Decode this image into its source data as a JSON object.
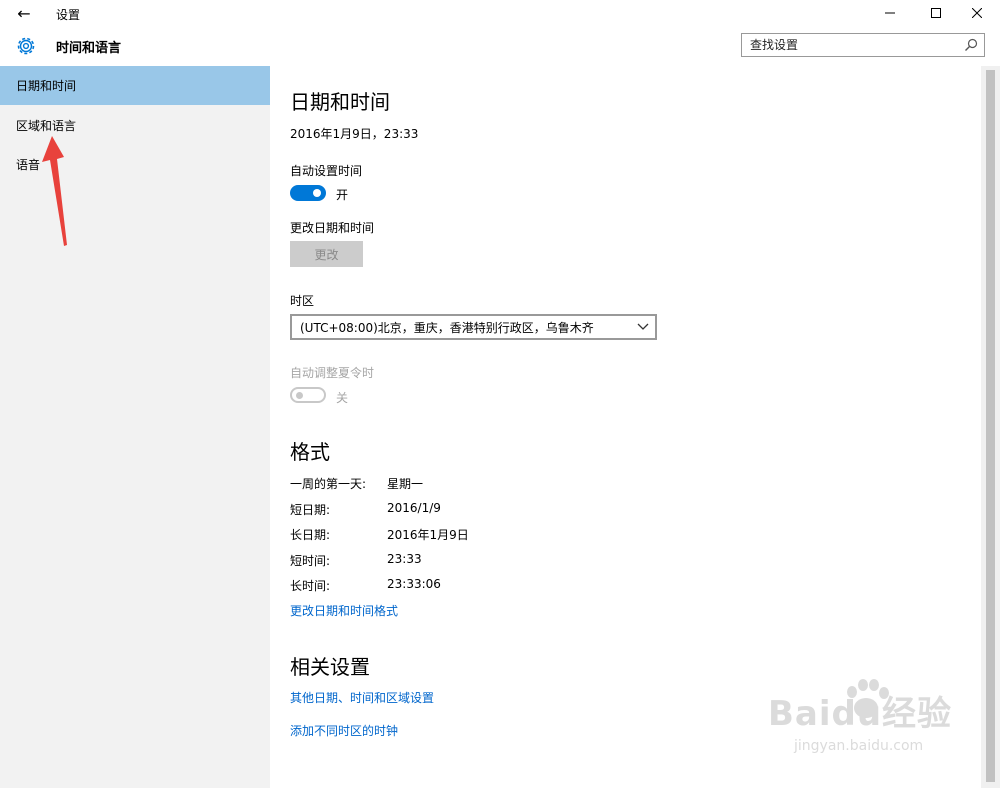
{
  "window": {
    "title": "设置",
    "back_icon": "←",
    "minimize_icon": "—",
    "maximize_icon": "☐",
    "close_icon": "✕"
  },
  "header": {
    "title": "时间和语言",
    "search_placeholder": "查找设置",
    "accent": "#0078d7"
  },
  "sidebar": {
    "items": [
      {
        "label": "日期和时间",
        "active": true
      },
      {
        "label": "区域和语言",
        "active": false
      },
      {
        "label": "语音",
        "active": false
      }
    ],
    "active_color": "#99c7e8",
    "annotation_arrow_color": "#e8423c"
  },
  "main": {
    "section_datetime": {
      "heading": "日期和时间",
      "current": "2016年1月9日，23:33",
      "auto_time_label": "自动设置时间",
      "auto_time_state": "开",
      "change_label": "更改日期和时间",
      "change_button": "更改",
      "timezone_label": "时区",
      "timezone_value": "(UTC+08:00)北京，重庆，香港特别行政区，乌鲁木齐",
      "dst_label": "自动调整夏令时",
      "dst_state": "关"
    },
    "section_format": {
      "heading": "格式",
      "rows": [
        {
          "key": "一周的第一天:",
          "value": "星期一"
        },
        {
          "key": "短日期:",
          "value": "2016/1/9"
        },
        {
          "key": "长日期:",
          "value": "2016年1月9日"
        },
        {
          "key": "短时间:",
          "value": "23:33"
        },
        {
          "key": "长时间:",
          "value": "23:33:06"
        }
      ],
      "link": "更改日期和时间格式"
    },
    "section_related": {
      "heading": "相关设置",
      "links": [
        "其他日期、时间和区域设置",
        "添加不同时区的时钟"
      ]
    }
  },
  "watermark": {
    "brand": "Baidu经验",
    "url": "jingyan.baidu.com"
  }
}
